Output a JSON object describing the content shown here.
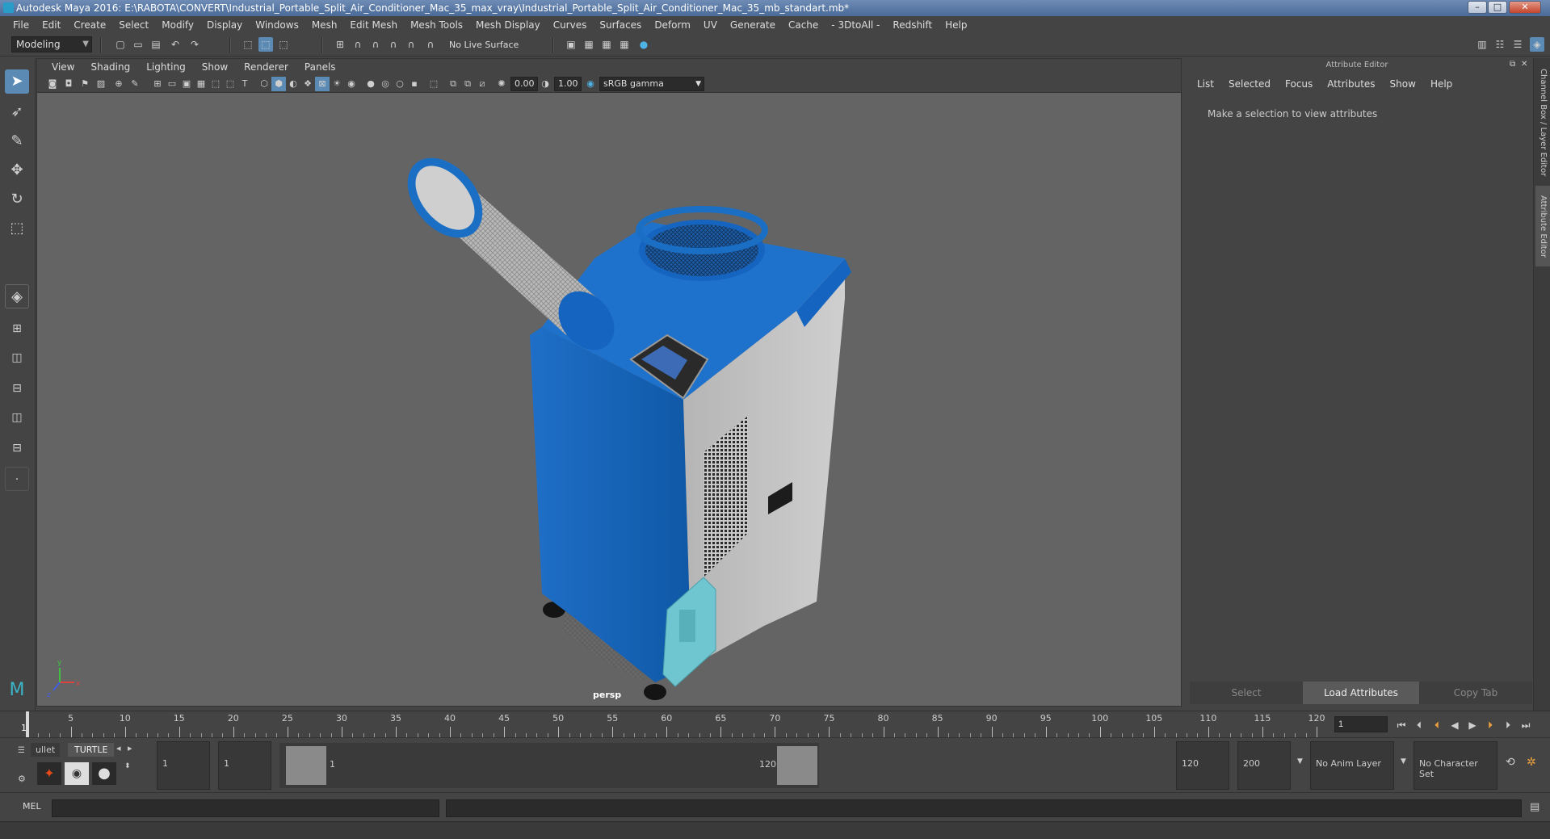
{
  "window": {
    "title": "Autodesk Maya 2016: E:\\RABOTA\\CONVERT\\Industrial_Portable_Split_Air_Conditioner_Mac_35_max_vray\\Industrial_Portable_Split_Air_Conditioner_Mac_35_mb_standart.mb*",
    "minimize": "–",
    "maximize": "□",
    "close": "✕"
  },
  "menubar": [
    "File",
    "Edit",
    "Create",
    "Select",
    "Modify",
    "Display",
    "Windows",
    "Mesh",
    "Edit Mesh",
    "Mesh Tools",
    "Mesh Display",
    "Curves",
    "Surfaces",
    "Deform",
    "UV",
    "Generate",
    "Cache",
    "- 3DtoAll -",
    "Redshift",
    "Help"
  ],
  "status_line": {
    "mode": "Modeling",
    "live_surface": "No Live Surface"
  },
  "viewport": {
    "menu": [
      "View",
      "Shading",
      "Lighting",
      "Show",
      "Renderer",
      "Panels"
    ],
    "exposure": "0.00",
    "gamma": "1.00",
    "color_space": "sRGB gamma",
    "camera_label": "persp",
    "axis_x": "x",
    "axis_y": "y",
    "axis_z": "z"
  },
  "attribute_editor": {
    "title": "Attribute Editor",
    "menu": [
      "List",
      "Selected",
      "Focus",
      "Attributes",
      "Show",
      "Help"
    ],
    "message": "Make a selection to view attributes",
    "buttons": {
      "select": "Select",
      "load": "Load Attributes",
      "copy": "Copy Tab"
    }
  },
  "side_tabs": {
    "channel_box": "Channel Box / Layer Editor",
    "attribute_editor": "Attribute Editor"
  },
  "timeline": {
    "start_marker": "1",
    "ticks": [
      5,
      10,
      15,
      20,
      25,
      30,
      35,
      40,
      45,
      50,
      55,
      60,
      65,
      70,
      75,
      80,
      85,
      90,
      95,
      100,
      105,
      110,
      115,
      120
    ],
    "current_frame": "1"
  },
  "range": {
    "shelf_tabs": [
      "ullet",
      "TURTLE"
    ],
    "start": "1",
    "playback_start": "1",
    "range_start_label": "1",
    "range_end_label": "120",
    "playback_end": "120",
    "end": "200",
    "anim_layer": "No Anim Layer",
    "character_set": "No Character Set"
  },
  "command_line": {
    "mode": "MEL"
  },
  "colors": {
    "accent": "#5b8bb5",
    "unit_blue": "#1565c0",
    "panel": "#444444"
  }
}
